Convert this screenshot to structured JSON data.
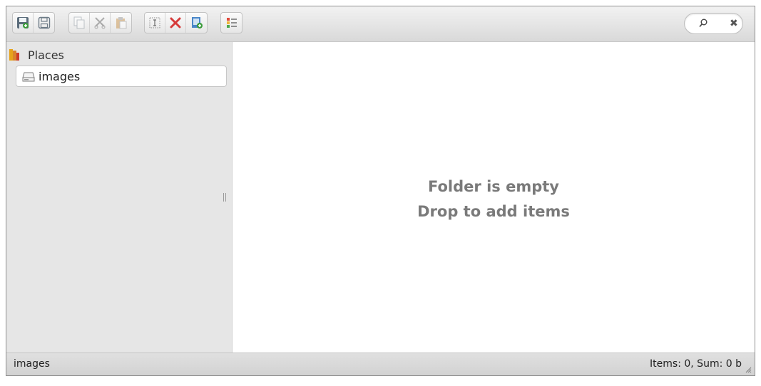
{
  "toolbar": {
    "groups": [
      [
        "save-icon",
        "save-as-icon"
      ],
      [
        "copy-icon",
        "cut-icon",
        "paste-icon"
      ],
      [
        "rename-icon",
        "delete-icon",
        "upload-icon"
      ],
      [
        "view-list-icon"
      ]
    ],
    "search": {
      "value": "",
      "placeholder": "",
      "clear_label": "✖"
    }
  },
  "sidebar": {
    "places_label": "Places",
    "items": [
      {
        "label": "images",
        "selected": true
      }
    ]
  },
  "main": {
    "empty_line1": "Folder is empty",
    "empty_line2": "Drop to add items"
  },
  "statusbar": {
    "path": "images",
    "summary": "Items: 0, Sum: 0 b"
  },
  "colors": {
    "sidebar_bg": "#e6e6e6",
    "empty_text": "#7a7a7a",
    "delete_red": "#d63b3b",
    "save_green": "#3a9b3a"
  }
}
